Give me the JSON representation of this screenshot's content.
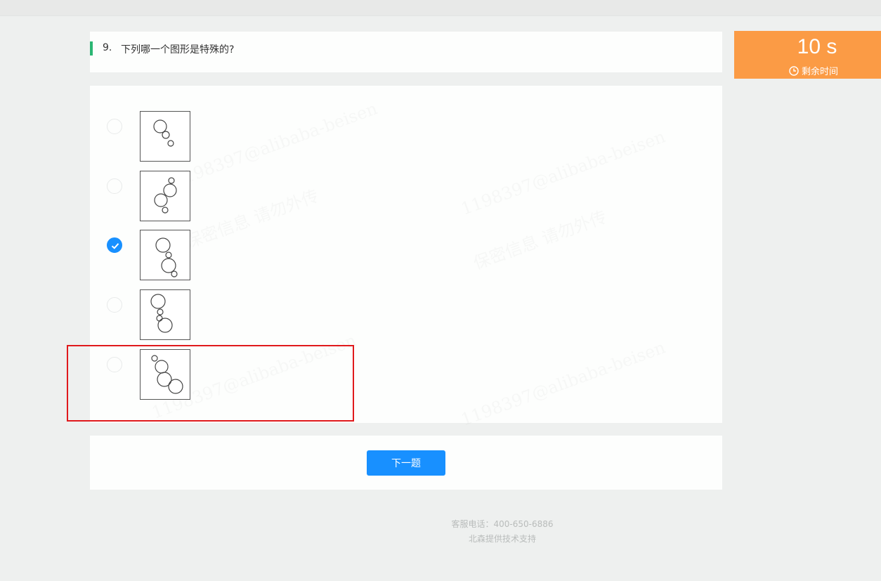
{
  "question": {
    "number": "9.",
    "text": "下列哪一个图形是特殊的?"
  },
  "options": [
    {
      "selected": false,
      "circles": [
        [
          28,
          21,
          9
        ],
        [
          36,
          33,
          5
        ],
        [
          43,
          45,
          4
        ]
      ]
    },
    {
      "selected": false,
      "circles": [
        [
          44,
          13,
          4
        ],
        [
          42,
          27,
          9
        ],
        [
          29,
          41,
          9
        ],
        [
          35,
          55,
          4
        ]
      ]
    },
    {
      "selected": true,
      "circles": [
        [
          32,
          21,
          10
        ],
        [
          40,
          35,
          4
        ],
        [
          40,
          50,
          10
        ],
        [
          48,
          62,
          4
        ]
      ]
    },
    {
      "selected": false,
      "circles": [
        [
          25,
          16,
          10
        ],
        [
          28,
          31,
          4
        ],
        [
          27,
          40,
          4
        ],
        [
          35,
          50,
          10
        ]
      ]
    },
    {
      "selected": false,
      "circles": [
        [
          20,
          12,
          4
        ],
        [
          30,
          24,
          9
        ],
        [
          34,
          42,
          10
        ],
        [
          50,
          52,
          10
        ]
      ]
    }
  ],
  "timer": {
    "value": "10 s",
    "label": "剩余时间",
    "icon": "clock-icon"
  },
  "next_button": "下一题",
  "footer": {
    "phone": "客服电话：400-650-6886",
    "support": "北森提供技术支持"
  },
  "colors": {
    "accent": "#2bb673",
    "primary": "#1890ff",
    "timer": "#fb9b45",
    "highlight": "#e0191c"
  }
}
